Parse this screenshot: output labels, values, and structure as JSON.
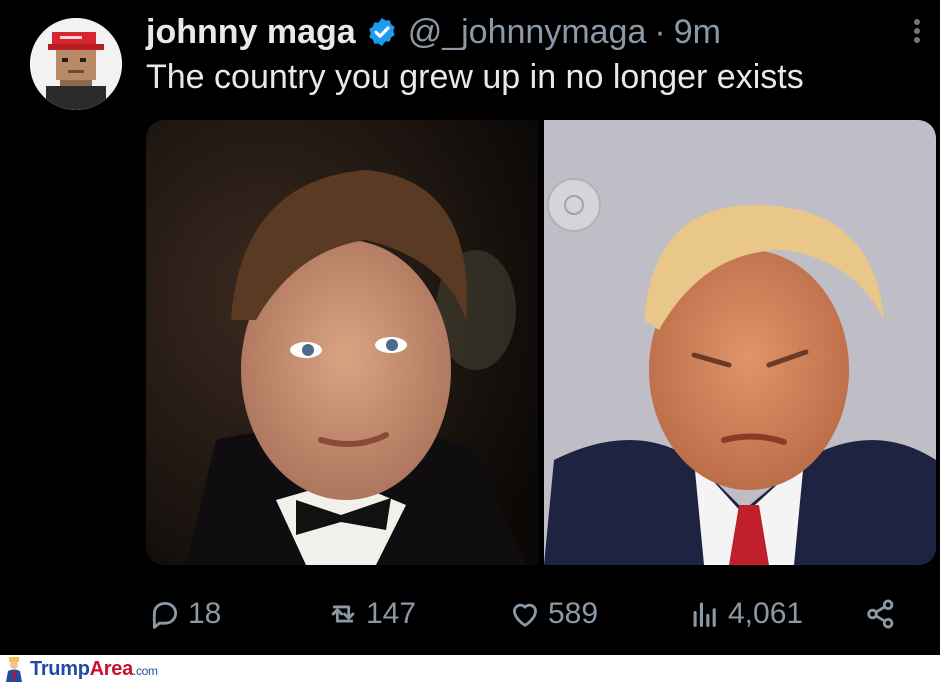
{
  "tweet": {
    "author_name": "johnny maga",
    "handle": "@_johnnymaga",
    "separator": "·",
    "time": "9m",
    "text": "The country you grew up in no longer exists",
    "verified": true
  },
  "media": {
    "count": 2
  },
  "actions": {
    "replies": "18",
    "reposts": "147",
    "likes": "589",
    "views": "4,061"
  },
  "watermark": {
    "part1": "Trump",
    "part2": "Area",
    "part3": ".com"
  },
  "colors": {
    "background": "#000000",
    "text": "#e7e9ea",
    "muted": "#8b98a5",
    "verified": "#1d9bf0"
  }
}
